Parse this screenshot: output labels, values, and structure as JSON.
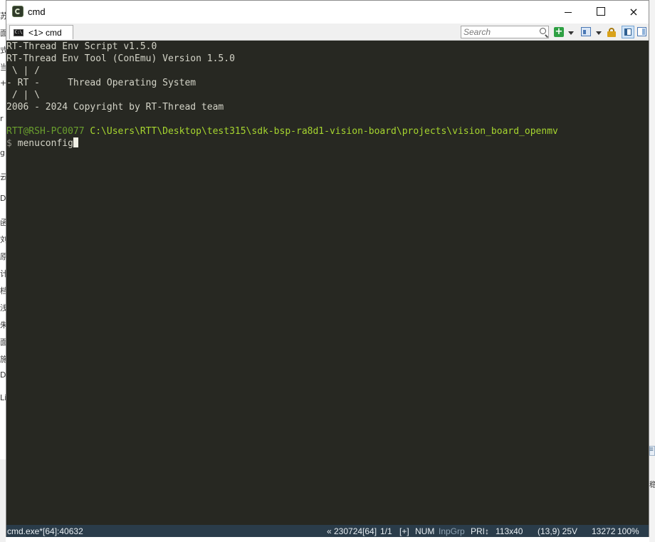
{
  "background": {
    "left_glyphs": [
      "苏",
      "面",
      "式",
      "当",
      "+-",
      "r",
      "g",
      "云",
      "Dr",
      "函",
      "刘",
      "原",
      "计",
      "档",
      "浅",
      "朱",
      "面",
      "施",
      "DU",
      "Lin"
    ],
    "right_glyphs": [
      "≡",
      "稳"
    ]
  },
  "window": {
    "title": "cmd",
    "controls": {
      "minimize": "minimize",
      "maximize": "maximize",
      "close": "×"
    }
  },
  "tabs": [
    {
      "label": "<1> cmd",
      "icon": "cmd-icon"
    }
  ],
  "toolbar": {
    "search_placeholder": "Search",
    "icons": [
      "search-icon",
      "new-console-icon",
      "dropdown-icon",
      "panel-icon",
      "dropdown-icon",
      "lock-icon",
      "split-layout-icon",
      "toggle-panel-icon"
    ]
  },
  "console": {
    "lines": [
      "RT-Thread Env Script v1.5.0",
      "RT-Thread Env Tool (ConEmu) Version 1.5.0",
      " \\ | /",
      "- RT -     Thread Operating System",
      " / | \\",
      "2006 - 2024 Copyright by RT-Thread team"
    ],
    "prompt_user": "RTT@RSH-PC0077",
    "prompt_path": " C:\\Users\\RTT\\Desktop\\test315\\sdk-bsp-ra8d1-vision-board\\projects\\vision_board_openmv",
    "prompt_sign": "$",
    "command": " menuconfig"
  },
  "status": {
    "process": "cmd.exe*[64]:40632",
    "buffer": "« 230724[64]",
    "page": "1/1",
    "plus": "[+]",
    "num": "NUM",
    "inpgrp": "InpGrp",
    "pri": "PRI↕",
    "size": "113x40",
    "cursor": "(13,9) 25V",
    "pid": "13272",
    "zoom": "100%"
  },
  "colors": {
    "console_bg": "#272822",
    "console_fg": "#d4d4c8",
    "prompt_user": "#6a9f2e",
    "prompt_path": "#a6d52f",
    "statusbar_bg": "#2a3c4a"
  }
}
